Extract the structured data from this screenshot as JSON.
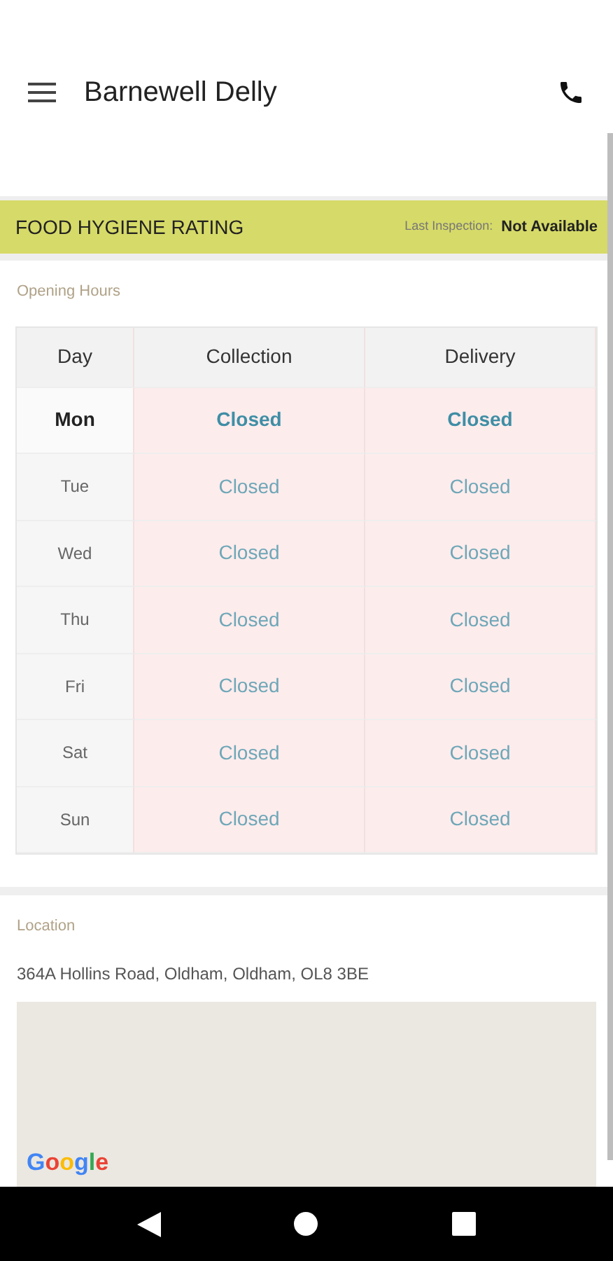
{
  "app_bar": {
    "title": "Barnewell Delly"
  },
  "hygiene": {
    "title": "FOOD HYGIENE RATING",
    "inspection_label": "Last Inspection:",
    "inspection_value": "Not Available"
  },
  "opening_hours": {
    "title": "Opening Hours",
    "columns": [
      "Day",
      "Collection",
      "Delivery"
    ],
    "rows": [
      {
        "day": "Mon",
        "collection": "Closed",
        "delivery": "Closed",
        "selected": true
      },
      {
        "day": "Tue",
        "collection": "Closed",
        "delivery": "Closed",
        "selected": false
      },
      {
        "day": "Wed",
        "collection": "Closed",
        "delivery": "Closed",
        "selected": false
      },
      {
        "day": "Thu",
        "collection": "Closed",
        "delivery": "Closed",
        "selected": false
      },
      {
        "day": "Fri",
        "collection": "Closed",
        "delivery": "Closed",
        "selected": false
      },
      {
        "day": "Sat",
        "collection": "Closed",
        "delivery": "Closed",
        "selected": false
      },
      {
        "day": "Sun",
        "collection": "Closed",
        "delivery": "Closed",
        "selected": false
      }
    ]
  },
  "location": {
    "title": "Location",
    "address": "364A Hollins Road, Oldham, Oldham, OL8 3BE",
    "map_logo": "Google"
  }
}
